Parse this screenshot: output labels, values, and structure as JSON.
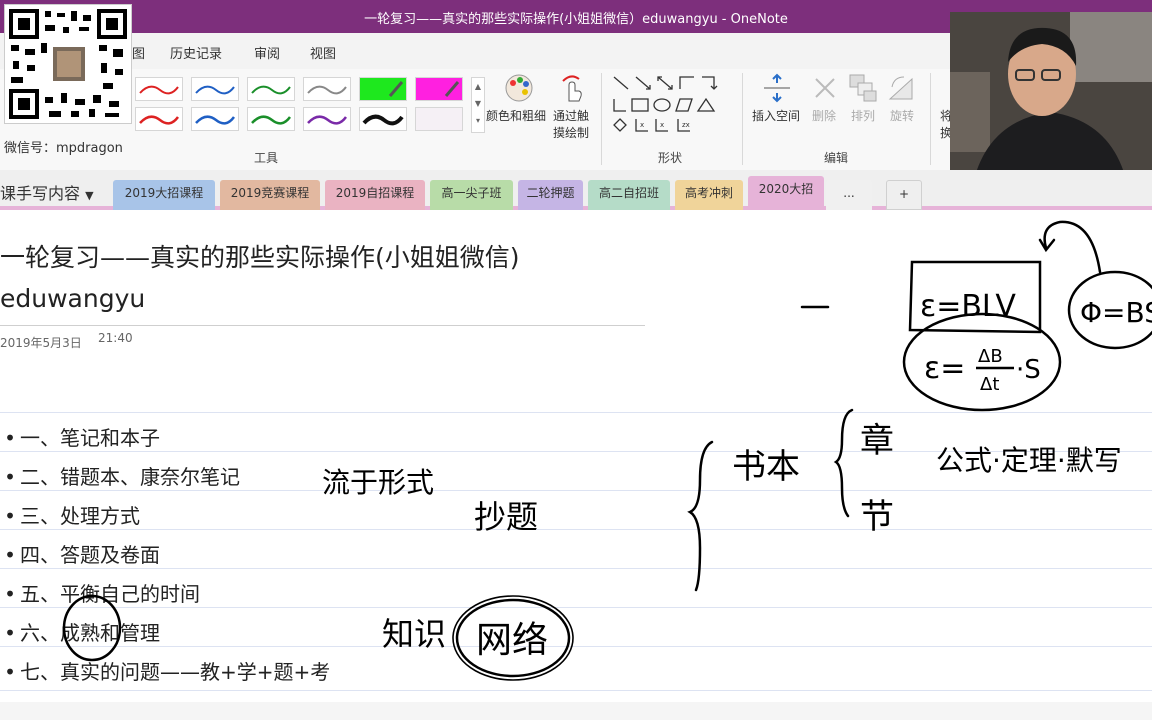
{
  "window": {
    "title": "一轮复习——真实的那些实际操作(小姐姐微信）eduwangyu  -  OneNote"
  },
  "ribbon_tabs": [
    "图",
    "历史记录",
    "审阅",
    "视图"
  ],
  "ribbon": {
    "color_width_label": "颜色和粗细",
    "touch_draw_label_1": "通过触",
    "touch_draw_label_2": "摸绘制",
    "insert_space_label": "插入空间",
    "delete_label": "删除",
    "arrange_label": "排列",
    "rotate_label": "旋转",
    "cut_label_1": "将",
    "cut_label_2": "换",
    "groups": {
      "tools": "工具",
      "shapes": "形状",
      "edit": "编辑"
    }
  },
  "overlay": {
    "wechat": "微信号：mpdragon"
  },
  "notebook": {
    "name": "课手写内容"
  },
  "sections": [
    {
      "label": "2019大招课程",
      "color": "#a8c4e8"
    },
    {
      "label": "2019竞赛课程",
      "color": "#e2b8a0"
    },
    {
      "label": "2019自招课程",
      "color": "#eab3c2"
    },
    {
      "label": "高一尖子班",
      "color": "#b8dca8"
    },
    {
      "label": "二轮押题",
      "color": "#c5b5e5"
    },
    {
      "label": "高二自招班",
      "color": "#b5dcc8"
    },
    {
      "label": "高考冲刺",
      "color": "#f0d49a"
    },
    {
      "label": "2020大招",
      "color": "#e6b3d8"
    },
    {
      "label": "...",
      "color": "#f0f0f0"
    },
    {
      "label": "+",
      "color": "#efefef"
    }
  ],
  "page": {
    "title": "一轮复习——真实的那些实际操作(小姐姐微信)",
    "author": "eduwangyu",
    "date": "2019年5月3日",
    "time": "21:40",
    "bullet": "•",
    "items": [
      "一、笔记和本子",
      "二、错题本、康奈尔笔记",
      "三、处理方式",
      "四、答题及卷面",
      "五、平衡自己的时间",
      "六、成熟和管理",
      "七、真实的问题——教+学+题+考"
    ]
  },
  "handwriting": {
    "liu_yu_xing_shi": "流于形式",
    "chao_ti": "抄题",
    "zhi_shi": "知识",
    "wang_luo": "网络",
    "shu_ben": "书本",
    "zhang": "章",
    "jie": "节",
    "gongshi": "公式·定理·默写",
    "eq1": "ε=BLV",
    "eq2_left": "ε=",
    "eq2_num": "ΔB",
    "eq2_den": "Δt",
    "eq2_right": "·S",
    "eq3": "Φ=BS"
  }
}
